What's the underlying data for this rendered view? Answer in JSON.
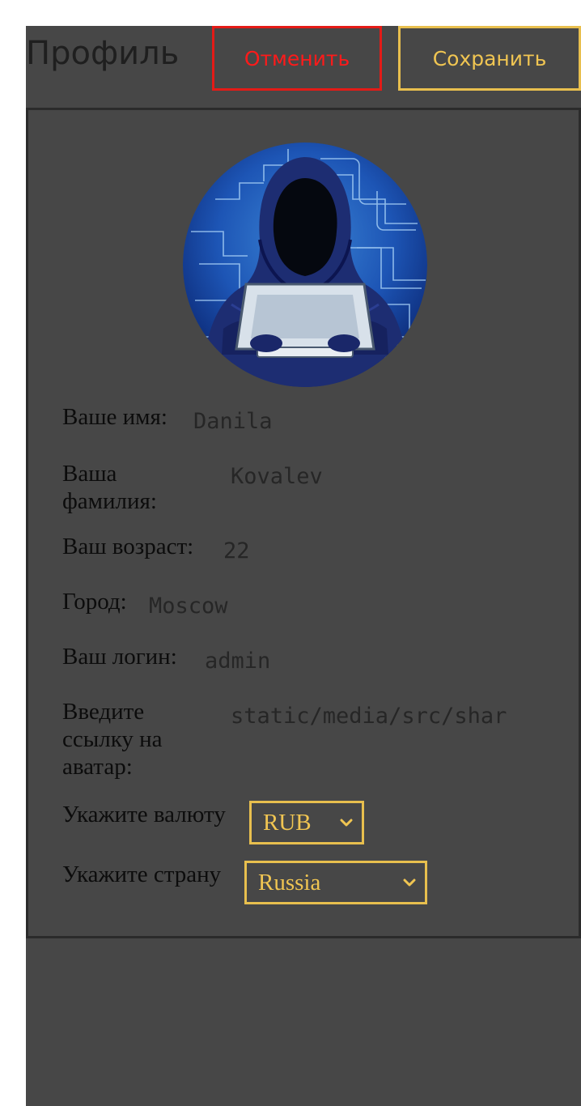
{
  "header": {
    "title": "Профиль",
    "cancel_label": "Отменить",
    "save_label": "Сохранить"
  },
  "profile": {
    "avatar": "hooded-hacker-avatar",
    "fields": {
      "first_name": {
        "label": "Ваше имя:",
        "value": "Danila"
      },
      "last_name": {
        "label": "Ваша фамилия:",
        "value": "Kovalev"
      },
      "age": {
        "label": "Ваш возраст:",
        "value": "22"
      },
      "city": {
        "label": "Город:",
        "value": "Moscow"
      },
      "login": {
        "label": "Ваш логин:",
        "value": "admin"
      },
      "avatar_url": {
        "label": "Введите ссылку на аватар:",
        "value": "static/media/src/shar"
      }
    },
    "currency": {
      "label": "Укажите валюту",
      "selected": "RUB"
    },
    "country": {
      "label": "Укажите страну",
      "selected": "Russia"
    }
  },
  "colors": {
    "background": "#474747",
    "cancel": "#ff1a1a",
    "accent": "#e8bf4e"
  }
}
